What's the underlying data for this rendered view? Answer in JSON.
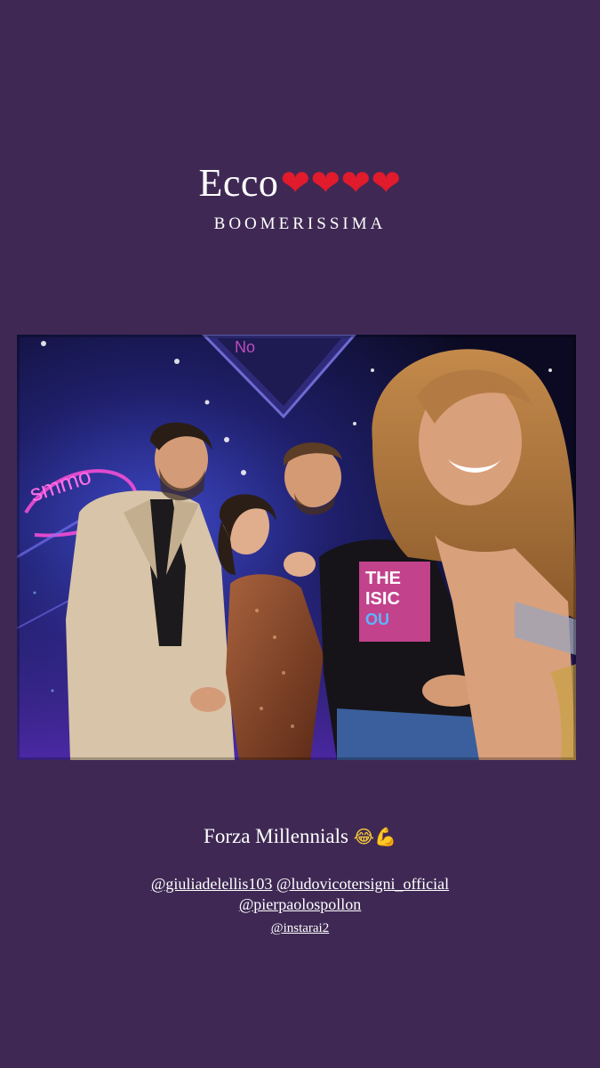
{
  "story": {
    "background_color": "#3f2954",
    "headline": {
      "text": "Ecco",
      "emoji": "❤❤❤❤"
    },
    "subline": "BOOMERISSIMA",
    "photo": {
      "description_icon": "selfie-photo"
    },
    "caption": {
      "text": "Forza Millennials",
      "emoji_1": "😂",
      "emoji_2": "💪"
    },
    "mentions": {
      "line1_a": "@giuliadelellis103",
      "line1_b": "@ludovicotersigni_official",
      "line2": "@pierpaolospollon",
      "line3": "@instarai2"
    }
  }
}
